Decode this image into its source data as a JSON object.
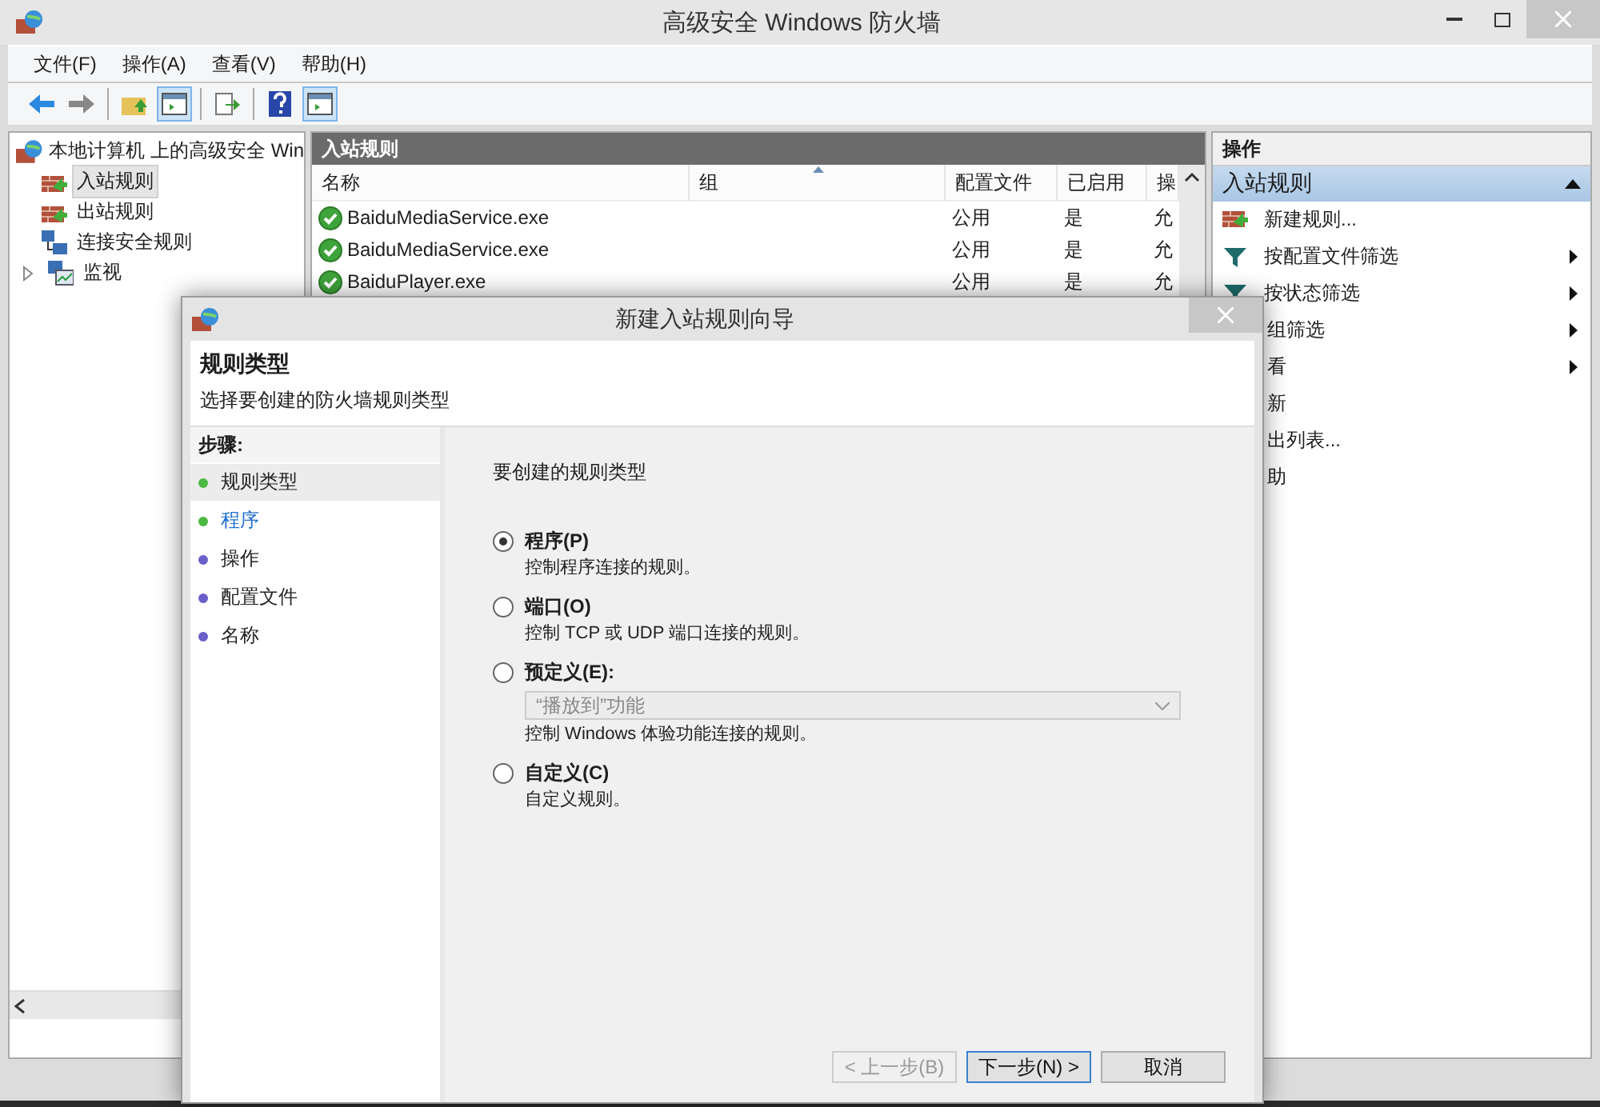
{
  "window": {
    "title": "高级安全 Windows 防火墙"
  },
  "menu": [
    "文件(F)",
    "操作(A)",
    "查看(V)",
    "帮助(H)"
  ],
  "toolbar": [
    [
      {
        "kind": "back",
        "pressed": false
      },
      {
        "kind": "forward",
        "pressed": false
      }
    ],
    [
      {
        "kind": "up",
        "pressed": false
      },
      {
        "kind": "panel",
        "pressed": true
      }
    ],
    [
      {
        "kind": "export",
        "pressed": false
      }
    ],
    [
      {
        "kind": "help",
        "pressed": false
      },
      {
        "kind": "panel",
        "pressed": true
      }
    ]
  ],
  "tree": {
    "root": "本地计算机 上的高级安全 Win",
    "items": [
      {
        "label": "入站规则",
        "kind": "inbound",
        "selected": true
      },
      {
        "label": "出站规则",
        "kind": "outbound",
        "selected": false
      },
      {
        "label": "连接安全规则",
        "kind": "security",
        "selected": false
      },
      {
        "label": "监视",
        "kind": "monitor",
        "selected": false,
        "expanded": false
      }
    ]
  },
  "rules": {
    "title": "入站规则",
    "columns": [
      {
        "label": "名称",
        "sorted": false
      },
      {
        "label": "组",
        "sorted": true
      },
      {
        "label": "配置文件",
        "sorted": false
      },
      {
        "label": "已启用",
        "sorted": false
      },
      {
        "label": "操",
        "sorted": false
      }
    ],
    "rows": [
      {
        "name": "BaiduMediaService.exe",
        "profile": "公用",
        "enabled": "是",
        "action": "允"
      },
      {
        "name": "BaiduMediaService.exe",
        "profile": "公用",
        "enabled": "是",
        "action": "允"
      },
      {
        "name": "BaiduPlayer.exe",
        "profile": "公用",
        "enabled": "是",
        "action": "允"
      }
    ]
  },
  "actions": {
    "title": "操作",
    "section": "入站规则",
    "items": [
      {
        "label": "新建规则...",
        "kind": "new",
        "submenu": false
      },
      {
        "label": "按配置文件筛选",
        "kind": "filter",
        "submenu": true
      },
      {
        "label": "按状态筛选",
        "kind": "filter",
        "submenu": true
      },
      {
        "label": "组筛选",
        "kind": "plain",
        "submenu": true
      },
      {
        "label": "看",
        "kind": "plain",
        "submenu": true
      },
      {
        "label": "新",
        "kind": "plain",
        "submenu": false
      },
      {
        "label": "出列表...",
        "kind": "plain",
        "submenu": false
      },
      {
        "label": "助",
        "kind": "plain",
        "submenu": false
      }
    ]
  },
  "dialog": {
    "title": "新建入站规则向导",
    "heading": "规则类型",
    "subheading": "选择要创建的防火墙规则类型",
    "steps_title": "步骤:",
    "steps": [
      {
        "label": "规则类型",
        "selected": true,
        "link": false,
        "color": "#4cb944"
      },
      {
        "label": "程序",
        "selected": false,
        "link": true,
        "color": "#4cb944"
      },
      {
        "label": "操作",
        "selected": false,
        "link": false,
        "color": "#6a5fc8"
      },
      {
        "label": "配置文件",
        "selected": false,
        "link": false,
        "color": "#6a5fc8"
      },
      {
        "label": "名称",
        "selected": false,
        "link": false,
        "color": "#6a5fc8"
      }
    ],
    "prompt": "要创建的规则类型",
    "options": [
      {
        "label": "程序(P)",
        "description": "控制程序连接的规则。",
        "selected": true
      },
      {
        "label": "端口(O)",
        "description": "控制 TCP 或 UDP 端口连接的规则。",
        "selected": false
      },
      {
        "label": "预定义(E):",
        "dropdown": {
          "value": "“播放到”功能",
          "disabled": true
        },
        "description": "控制 Windows 体验功能连接的规则。",
        "selected": false
      },
      {
        "label": "自定义(C)",
        "description": "自定义规则。",
        "selected": false
      }
    ],
    "buttons": [
      {
        "label": "< 上一步(B)",
        "disabled": true,
        "default": false
      },
      {
        "label": "下一步(N) >",
        "disabled": false,
        "default": true
      },
      {
        "label": "取消",
        "disabled": false,
        "default": false
      }
    ]
  }
}
